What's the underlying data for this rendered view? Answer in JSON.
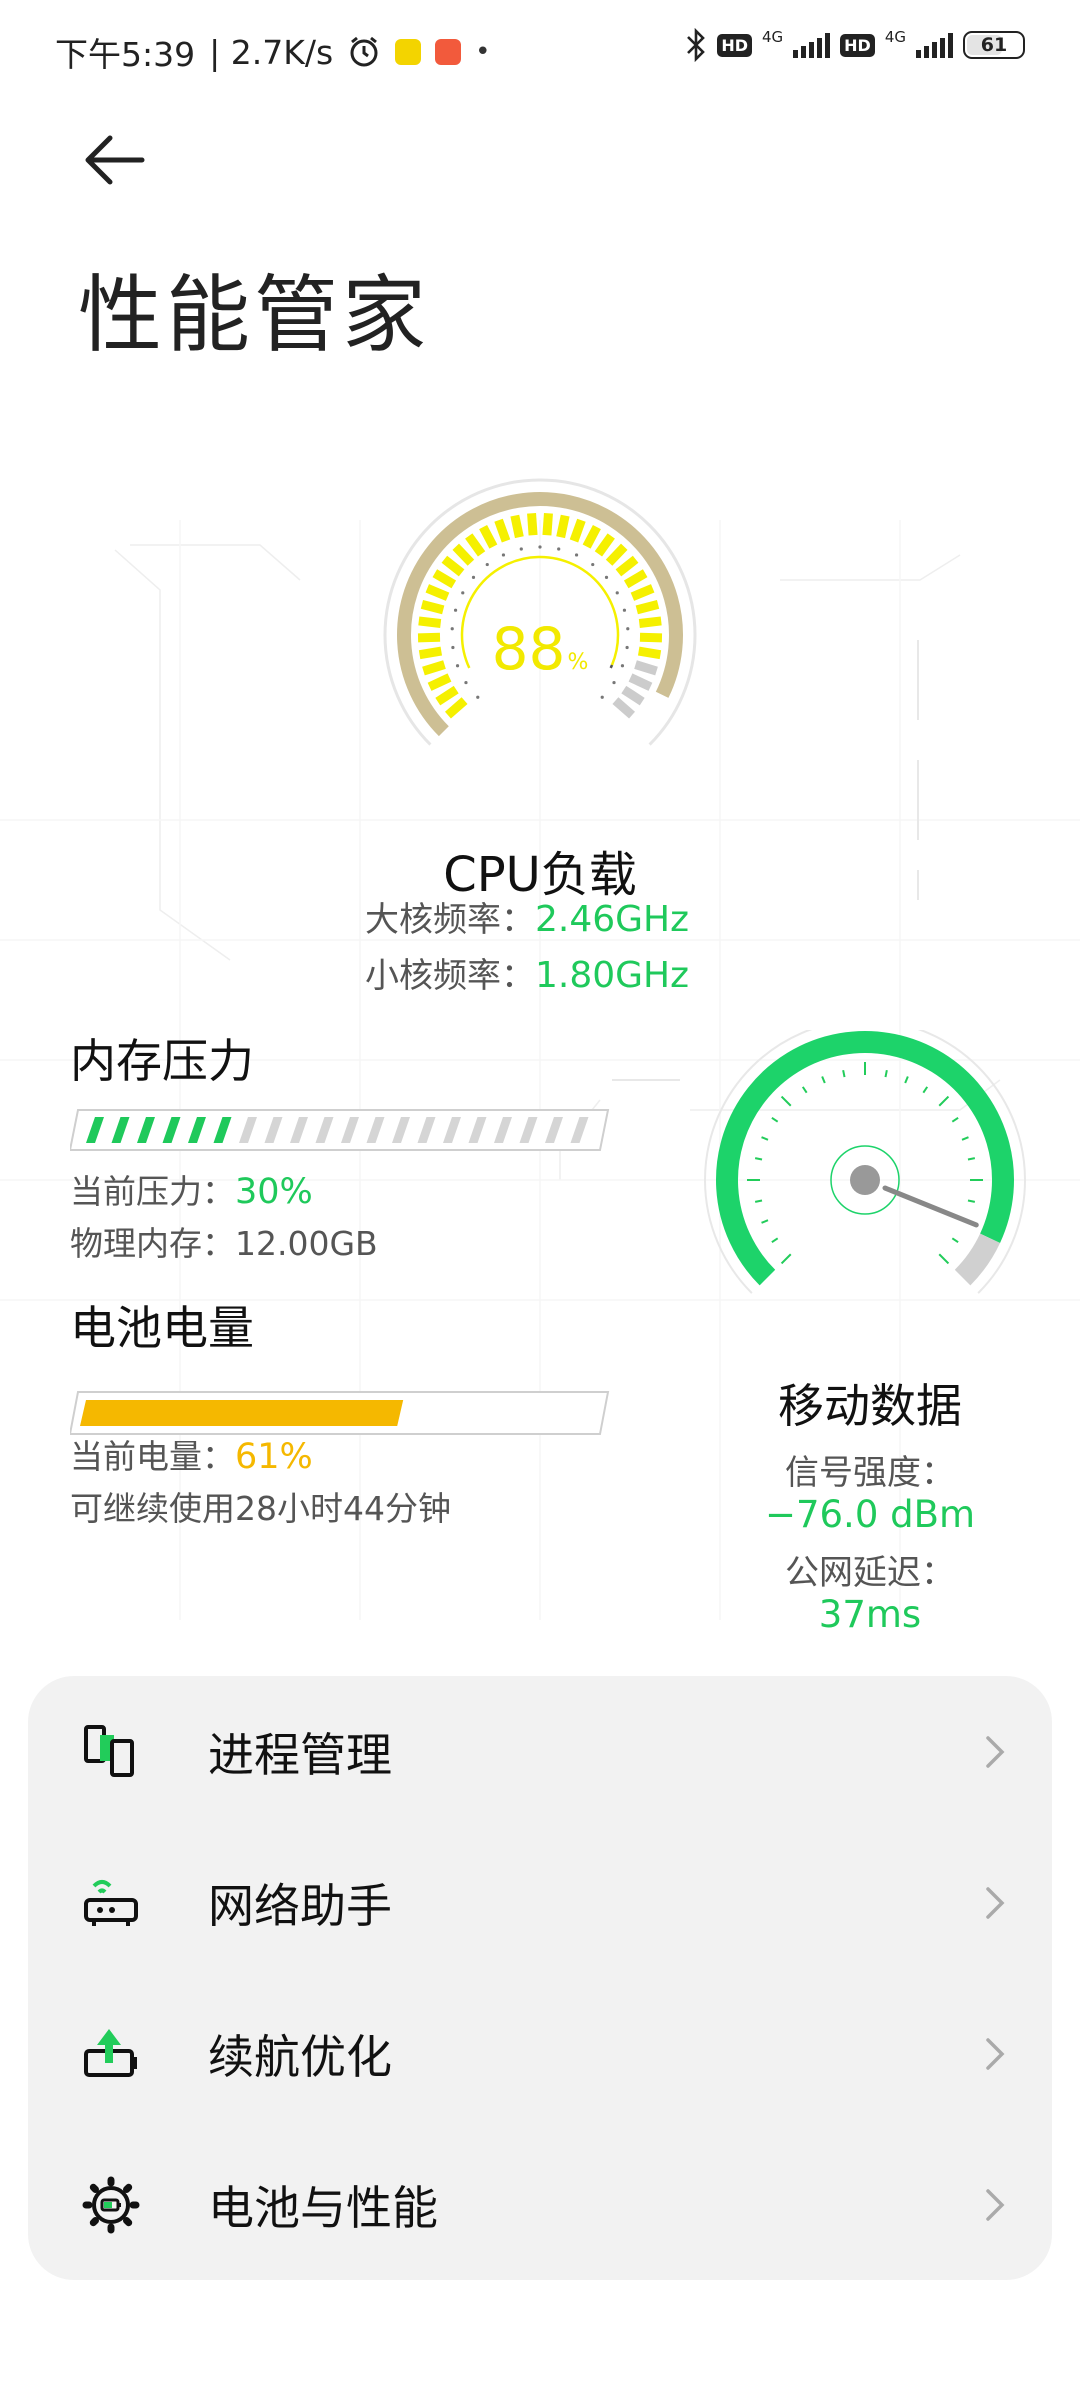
{
  "status_bar": {
    "time": "下午5:39",
    "net_speed": "| 2.7K/s",
    "hd1": "HD",
    "hd2": "HD",
    "net1": "4G",
    "net2": "4G",
    "battery": "61",
    "icons": [
      "alarm-icon",
      "notification-icon",
      "notification-icon-2",
      "bluetooth-icon",
      "signal-icon",
      "battery-icon"
    ],
    "chip_colors": [
      "#f3d400",
      "#f25a3c"
    ]
  },
  "header": {
    "title": "性能管家",
    "back_icon": "arrow-left-icon"
  },
  "cpu": {
    "value": "88",
    "unit": "%",
    "load": 0.88,
    "title": "CPU负载",
    "big_core_label": "大核频率：",
    "big_core_value": "2.46GHz",
    "little_core_label": "小核频率：",
    "little_core_value": "1.80GHz",
    "gauge_color": "#f5f000",
    "ring_color": "#cdbf94"
  },
  "memory": {
    "title": "内存压力",
    "pressure_label": "当前压力：",
    "pressure_value": "30%",
    "pressure": 0.3,
    "physical_label": "物理内存：",
    "physical_value": "12.00GB",
    "accent": "#1fc95b"
  },
  "battery_section": {
    "title": "电池电量",
    "level_label": "当前电量：",
    "level_value": "61%",
    "level": 0.61,
    "remaining": "可继续使用28小时44分钟",
    "accent": "#f5b800"
  },
  "network": {
    "title": "移动数据",
    "signal_label": "信号强度：",
    "signal_value": "−76.0 dBm",
    "latency_label": "公网延迟：",
    "latency_value": "37ms",
    "accent": "#1dd36a"
  },
  "menu": {
    "items": [
      {
        "label": "进程管理",
        "icon": "process-manager-icon"
      },
      {
        "label": "网络助手",
        "icon": "network-assistant-icon"
      },
      {
        "label": "续航优化",
        "icon": "battery-optimize-icon"
      },
      {
        "label": "电池与性能",
        "icon": "settings-gear-icon"
      }
    ]
  }
}
